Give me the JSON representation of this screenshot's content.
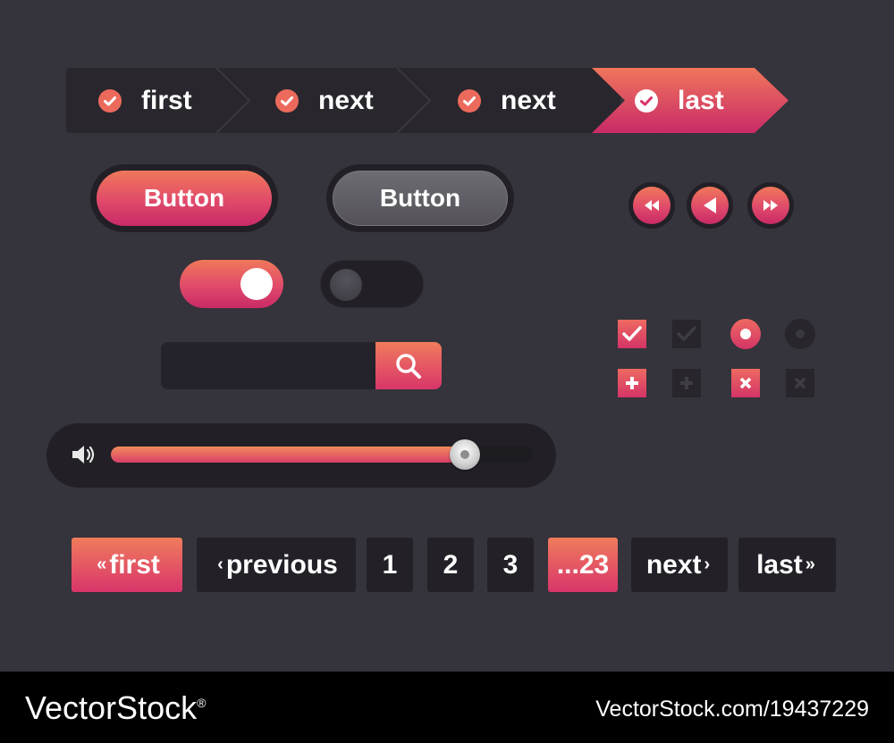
{
  "stepper": {
    "steps": [
      {
        "label": "first",
        "state": "done"
      },
      {
        "label": "next",
        "state": "done"
      },
      {
        "label": "next",
        "state": "done"
      },
      {
        "label": "last",
        "state": "active"
      }
    ]
  },
  "buttons": {
    "primary_label": "Button",
    "secondary_label": "Button"
  },
  "media": {
    "controls": [
      "rewind-icon",
      "play-reverse-icon",
      "fast-forward-icon"
    ]
  },
  "toggles": [
    {
      "state": "on"
    },
    {
      "state": "off"
    }
  ],
  "search": {
    "placeholder": "",
    "icon": "search-icon"
  },
  "checkboxes": [
    {
      "icon": "check-icon",
      "checked": true
    },
    {
      "icon": "check-icon",
      "checked": false
    },
    {
      "icon": "plus-icon",
      "checked": true
    },
    {
      "icon": "plus-icon",
      "checked": false
    },
    {
      "icon": "close-icon",
      "checked": true
    },
    {
      "icon": "close-icon",
      "checked": false
    }
  ],
  "radios": [
    {
      "selected": true
    },
    {
      "selected": false
    }
  ],
  "volume": {
    "icon": "speaker-icon",
    "level": 0.84
  },
  "pagination": {
    "first_arrow": "«",
    "first_label": "first",
    "prev_arrow": "‹",
    "prev_label": "previous",
    "pages": [
      "1",
      "2",
      "3"
    ],
    "current": "...23",
    "next_label": "next",
    "next_arrow": "›",
    "last_label": "last",
    "last_arrow": "»"
  },
  "footer": {
    "brand": "VectorStock",
    "brand_mark": "®",
    "ref": "VectorStock.com/19437229"
  },
  "colors": {
    "background": "#35333b",
    "accent_top": "#f0785a",
    "accent_bottom": "#c92a67",
    "dark_control": "#232127"
  }
}
